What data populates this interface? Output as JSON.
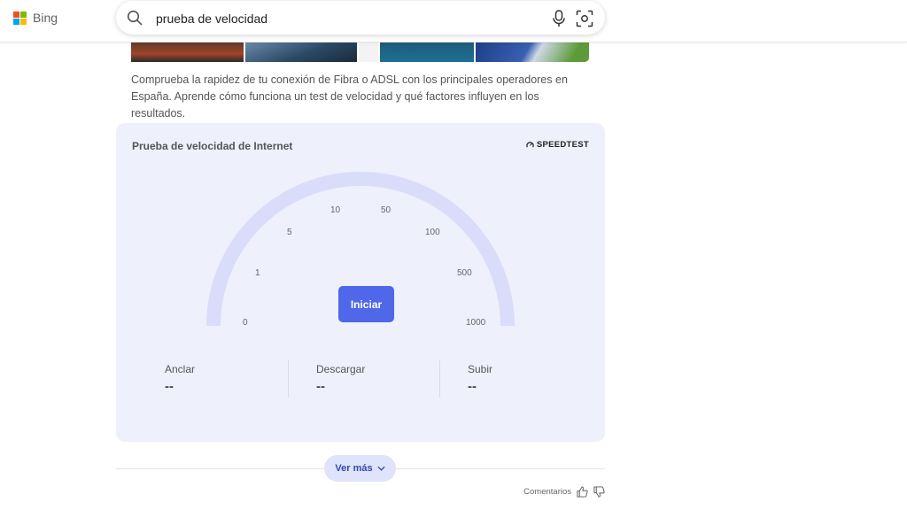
{
  "header": {
    "brand": "Bing",
    "search_value": "prueba de velocidad"
  },
  "result": {
    "description": "Comprueba la rapidez de tu conexión de Fibra o ADSL con los principales operadores en España. Aprende cómo funciona un test de velocidad y qué factores influyen en los resultados."
  },
  "speedtest": {
    "title": "Prueba de velocidad de Internet",
    "brand": "SPEEDTEST",
    "ticks": [
      "0",
      "1",
      "5",
      "10",
      "50",
      "100",
      "500",
      "1000"
    ],
    "start_label": "Iniciar",
    "metrics": [
      {
        "label": "Anclar",
        "value": "--"
      },
      {
        "label": "Descargar",
        "value": "--"
      },
      {
        "label": "Subir",
        "value": "--"
      }
    ]
  },
  "footer": {
    "more_label": "Ver más",
    "feedback_label": "Comentarios"
  },
  "colors": {
    "accent": "#4f67e8",
    "card_bg": "#eef0fc",
    "gauge_arc": "#d9ddfa"
  },
  "icons": {
    "search": "search-icon",
    "mic": "microphone-icon",
    "visual": "visual-search-icon",
    "speedtest": "speedometer-icon",
    "chevron": "chevron-down-icon",
    "like": "thumbs-up-icon",
    "dislike": "thumbs-down-icon"
  }
}
